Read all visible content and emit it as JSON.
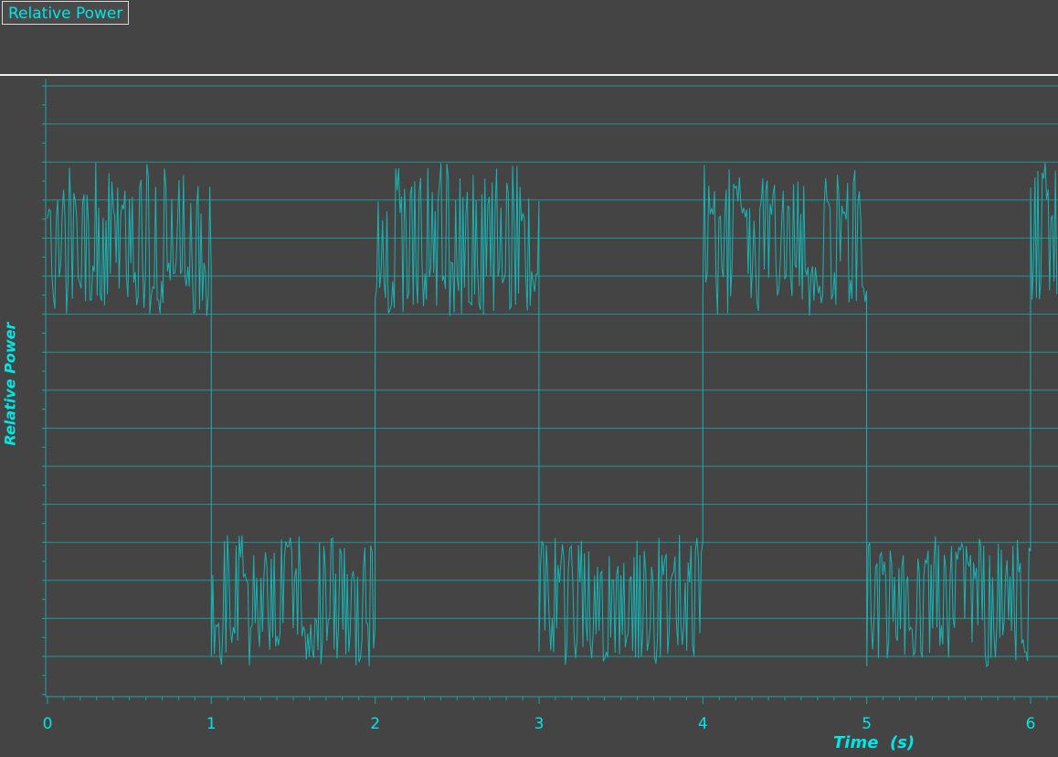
{
  "window": {
    "title": "Relative Power"
  },
  "colors": {
    "background": "#444444",
    "accent": "#00e5e5",
    "signal": "#1ab3b3",
    "gridline": "#1aa6a6",
    "divider": "#f0f0f0"
  },
  "chart_data": {
    "type": "line",
    "title": "",
    "xlabel": "Time  (s)",
    "ylabel": "Relative Power",
    "xlim": [
      0,
      6.2
    ],
    "xticks": [
      "0",
      "1",
      "2",
      "3",
      "4",
      "5",
      "6"
    ],
    "grid": true,
    "series": [
      {
        "segments": [
          {
            "t_start": 0.0,
            "t_end": 1.0,
            "level": "high"
          },
          {
            "t_start": 1.0,
            "t_end": 2.0,
            "level": "low"
          },
          {
            "t_start": 2.0,
            "t_end": 3.0,
            "level": "high"
          },
          {
            "t_start": 3.0,
            "t_end": 4.0,
            "level": "low"
          },
          {
            "t_start": 4.0,
            "t_end": 5.0,
            "level": "high"
          },
          {
            "t_start": 5.0,
            "t_end": 6.0,
            "level": "low"
          },
          {
            "t_start": 6.0,
            "t_end": 6.2,
            "level": "high"
          }
        ]
      }
    ]
  }
}
